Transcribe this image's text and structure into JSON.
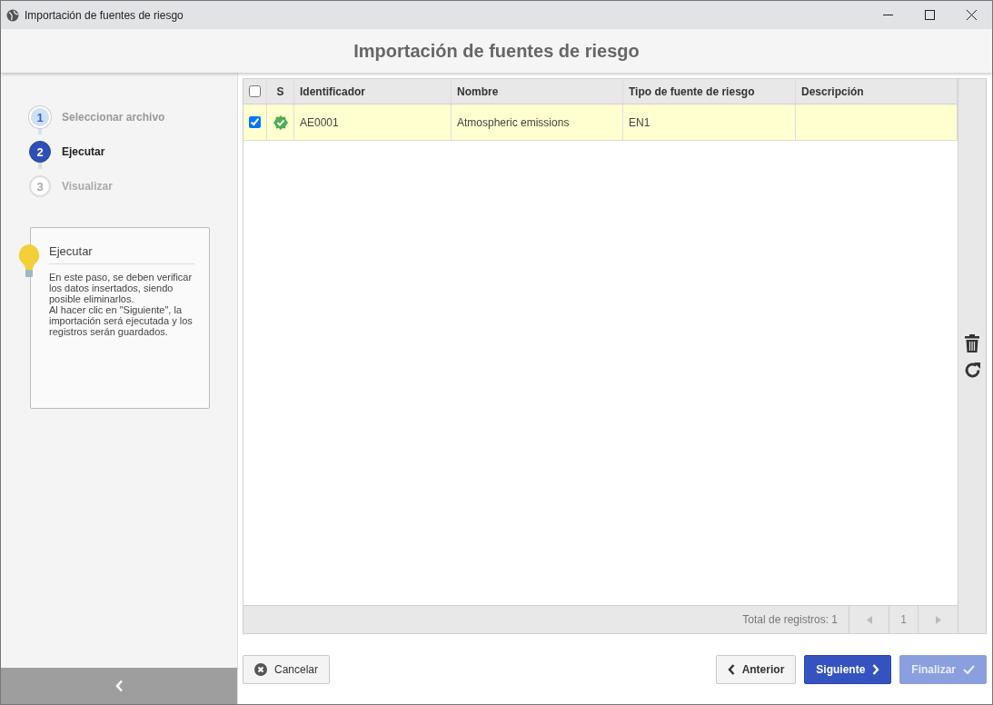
{
  "window": {
    "title": "Importación de fuentes de riesgo"
  },
  "header": {
    "title": "Importación de fuentes de riesgo"
  },
  "steps": [
    {
      "number": "1",
      "label": "Seleccionar archivo",
      "kind": "done"
    },
    {
      "number": "2",
      "label": "Ejecutar",
      "kind": "current"
    },
    {
      "number": "3",
      "label": "Visualizar",
      "kind": "pending"
    }
  ],
  "help": {
    "title": "Ejecutar",
    "text": "En este paso, se deben verificar los datos insertados, siendo posible eliminarlos.\nAl hacer clic en \"Siguiente\", la importación será ejecutada y los registros serán guardados."
  },
  "table": {
    "select_all": {
      "checked": false
    },
    "status_header": "S",
    "columns": [
      "Identificador",
      "Nombre",
      "Tipo de fuente de riesgo",
      "Descripción"
    ],
    "rows": [
      {
        "checked": true,
        "selected": true,
        "status_ok": true,
        "cells": [
          "AE0001",
          "Atmospheric emissions",
          "EN1",
          ""
        ]
      }
    ],
    "footer": {
      "total": "Total de registros: 1",
      "page": "1"
    }
  },
  "buttons": [
    {
      "label": "Cancelar",
      "kind": "cancel",
      "disabled": false
    },
    {
      "label": "Anterior",
      "kind": "back",
      "disabled": false
    },
    {
      "label": "Siguiente",
      "kind": "next",
      "disabled": false
    },
    {
      "label": "Finalizar",
      "kind": "finish",
      "disabled": true
    }
  ]
}
